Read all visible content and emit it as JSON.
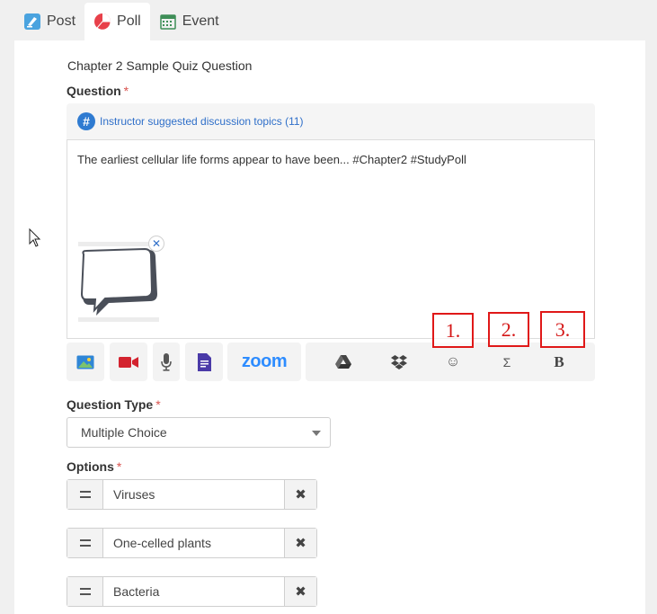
{
  "tabs": [
    {
      "label": "Post",
      "icon": "post-icon"
    },
    {
      "label": "Poll",
      "icon": "poll-icon"
    },
    {
      "label": "Event",
      "icon": "calendar-icon"
    }
  ],
  "form": {
    "title": "Chapter 2 Sample Quiz Question",
    "question_label": "Question",
    "required_mark": "*",
    "topics_link": "Instructor suggested discussion topics (11)",
    "question_text": "The earliest cellular life forms appear to have been... #Chapter2 #StudyPoll",
    "question_type_label": "Question Type",
    "question_type_value": "Multiple Choice",
    "options_label": "Options",
    "options": [
      "Viruses",
      "One-celled plants",
      "Bacteria"
    ]
  },
  "toolbar": {
    "zoom_label": "zoom",
    "emoji_glyph": "☺",
    "sigma_glyph": "Σ",
    "bold_glyph": "B",
    "icons": [
      "image-icon",
      "video-icon",
      "microphone-icon",
      "document-icon",
      "zoom-logo",
      "google-drive-icon",
      "dropbox-icon",
      "emoji-icon",
      "sigma-icon",
      "bold-icon"
    ]
  },
  "annotations": [
    "1.",
    "2.",
    "3."
  ],
  "colors": {
    "accent": "#2f6fc9",
    "required": "#d9534f",
    "annotation": "#e01818",
    "zoom": "#2d8cff",
    "video": "#d3232f",
    "docs": "#4a3aa8"
  }
}
